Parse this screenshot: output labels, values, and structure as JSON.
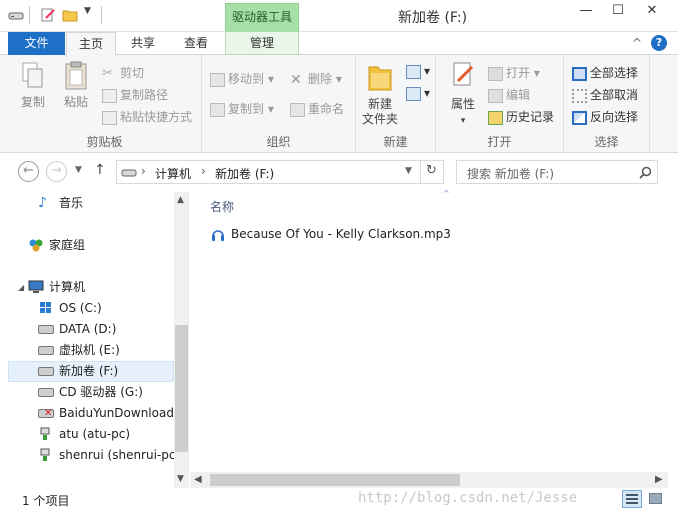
{
  "window": {
    "title": "新加卷 (F:)",
    "context_tab_label": "驱动器工具",
    "controls": {
      "minimize": "—",
      "maximize": "☐",
      "close": "✕"
    }
  },
  "tabs": {
    "file": "文件",
    "home": "主页",
    "share": "共享",
    "view": "查看",
    "manage": "管理",
    "collapse_glyph": "^",
    "help_glyph": "?"
  },
  "ribbon": {
    "clipboard": {
      "label": "剪贴板",
      "copy": "复制",
      "paste": "粘贴",
      "cut": "剪切",
      "copy_path": "复制路径",
      "paste_shortcut": "粘贴快捷方式"
    },
    "organize": {
      "label": "组织",
      "move_to": "移动到",
      "copy_to": "复制到",
      "delete": "删除",
      "rename": "重命名"
    },
    "new": {
      "label": "新建",
      "new_folder_line1": "新建",
      "new_folder_line2": "文件夹"
    },
    "open": {
      "label": "打开",
      "properties": "属性",
      "open": "打开",
      "edit": "编辑",
      "history": "历史记录"
    },
    "select": {
      "label": "选择",
      "select_all": "全部选择",
      "select_none": "全部取消",
      "invert": "反向选择"
    }
  },
  "address": {
    "back": "←",
    "forward": "→",
    "up": "↑",
    "crumb_computer": "计算机",
    "crumb_volume": "新加卷 (F:)",
    "separator": "›",
    "refresh": "↻",
    "search_placeholder": "搜索 新加卷 (F:)"
  },
  "nav": {
    "music": "音乐",
    "homegroup": "家庭组",
    "computer": "计算机",
    "drives": [
      {
        "label": "OS (C:)",
        "type": "windows-drive"
      },
      {
        "label": "DATA (D:)",
        "type": "drive"
      },
      {
        "label": "虚拟机 (E:)",
        "type": "drive"
      },
      {
        "label": "新加卷 (F:)",
        "type": "drive",
        "selected": true
      },
      {
        "label": "CD 驱动器 (G:)",
        "type": "cd-drive"
      },
      {
        "label": "BaiduYunDownload",
        "type": "disconnected-drive"
      },
      {
        "label": "atu (atu-pc)",
        "type": "network"
      },
      {
        "label": "shenrui (shenrui-pc)",
        "type": "network"
      }
    ]
  },
  "content": {
    "column_name": "名称",
    "files": [
      {
        "name": "Because Of You - Kelly Clarkson.mp3",
        "icon": "audio-file-icon"
      }
    ]
  },
  "status": {
    "item_count": "1 个项目"
  },
  "watermark": "http://blog.csdn.net/Jesse"
}
